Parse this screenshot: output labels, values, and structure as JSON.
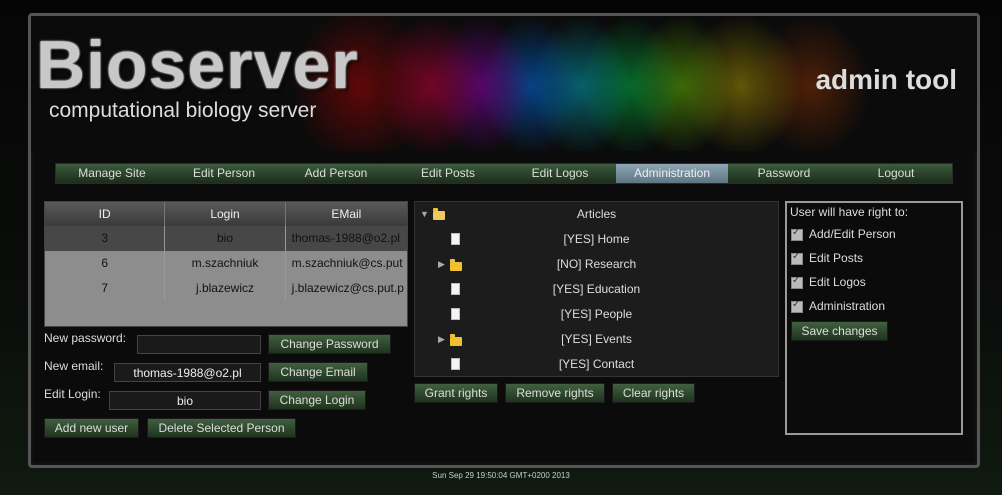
{
  "header": {
    "title": "Bioserver",
    "subtitle": "computational biology server",
    "tool": "admin tool"
  },
  "nav": [
    {
      "label": "Manage Site",
      "active": false
    },
    {
      "label": "Edit Person",
      "active": false
    },
    {
      "label": "Add Person",
      "active": false
    },
    {
      "label": "Edit Posts",
      "active": false
    },
    {
      "label": "Edit Logos",
      "active": false
    },
    {
      "label": "Administration",
      "active": true
    },
    {
      "label": "Password",
      "active": false
    },
    {
      "label": "Logout",
      "active": false
    }
  ],
  "users": {
    "columns": [
      "ID",
      "Login",
      "EMail"
    ],
    "rows": [
      {
        "id": "3",
        "login": "bio",
        "email": "thomas-1988@o2.pl",
        "selected": true
      },
      {
        "id": "6",
        "login": "m.szachniuk",
        "email": "m.szachniuk@cs.put",
        "selected": false
      },
      {
        "id": "7",
        "login": "j.blazewicz",
        "email": "j.blazewicz@cs.put.p",
        "selected": false
      }
    ]
  },
  "form": {
    "password_label": "New password:",
    "password_value": "",
    "change_password": "Change Password",
    "email_label": "New email:",
    "email_value": "thomas-1988@o2.pl",
    "change_email": "Change Email",
    "login_label": "Edit Login:",
    "login_value": "bio",
    "change_login": "Change Login",
    "add_user": "Add new user",
    "delete_user": "Delete Selected Person"
  },
  "articles": {
    "root": "Articles",
    "items": [
      {
        "label": "[YES] Home",
        "type": "page"
      },
      {
        "label": "[NO] Research",
        "type": "folder"
      },
      {
        "label": "[YES] Education",
        "type": "page"
      },
      {
        "label": "[YES] People",
        "type": "page"
      },
      {
        "label": "[YES] Events",
        "type": "folder"
      },
      {
        "label": "[YES] Contact",
        "type": "page"
      }
    ],
    "grant": "Grant rights",
    "remove": "Remove rights",
    "clear": "Clear rights"
  },
  "rights": {
    "title": "User will have right to:",
    "items": [
      {
        "label": "Add/Edit Person",
        "checked": true
      },
      {
        "label": "Edit Posts",
        "checked": true
      },
      {
        "label": "Edit Logos",
        "checked": true
      },
      {
        "label": "Administration",
        "checked": true
      }
    ],
    "save": "Save changes"
  },
  "footer": "Sun Sep 29 19:50:04 GMT+0200 2013"
}
